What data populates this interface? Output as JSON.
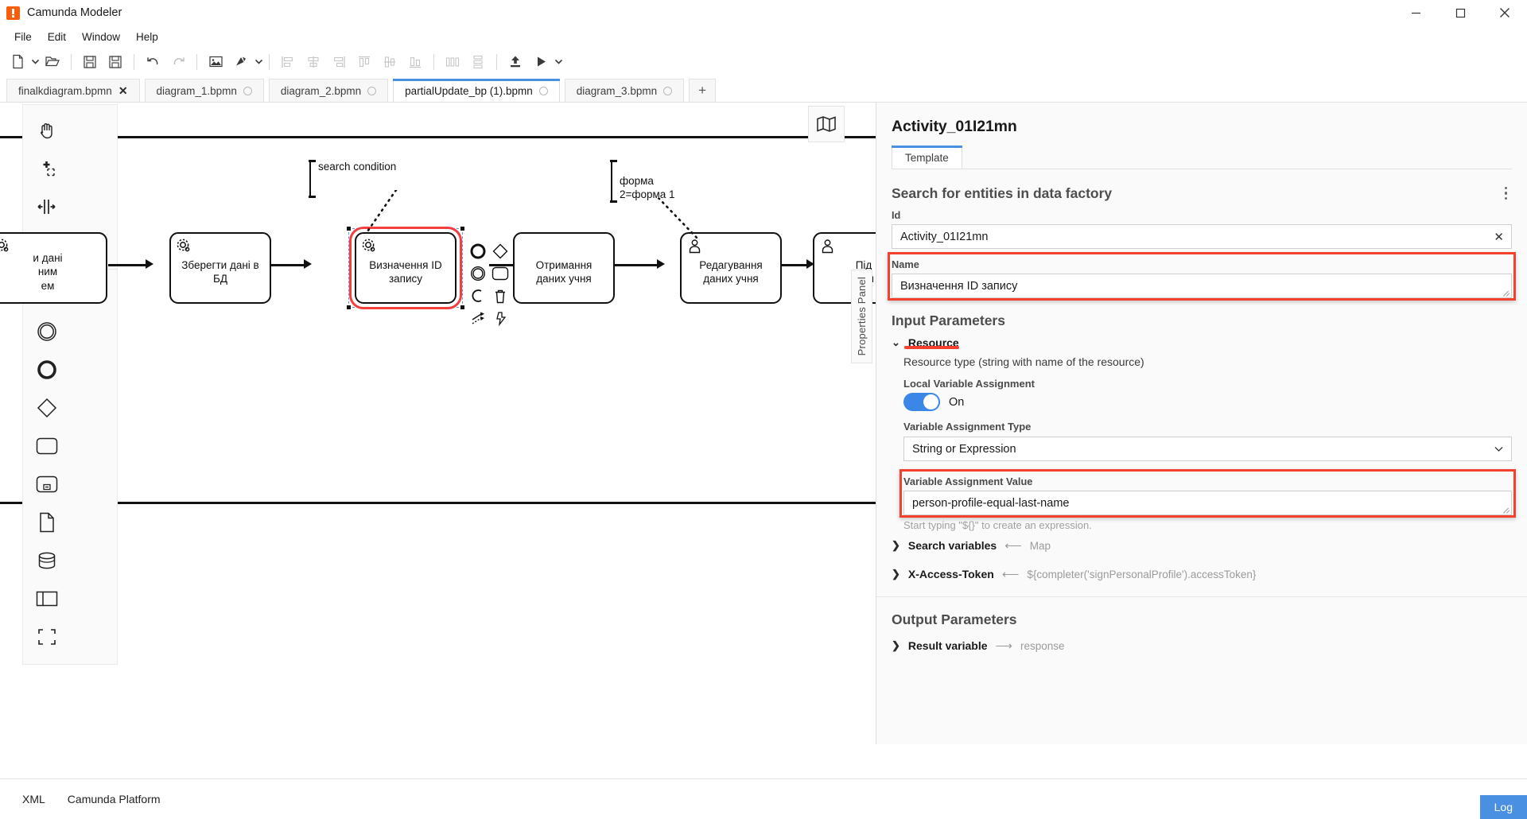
{
  "window": {
    "title": "Camunda Modeler",
    "controls": [
      {
        "name": "minimize",
        "glyph": "minimize-icon"
      },
      {
        "name": "maximize",
        "glyph": "maximize-icon"
      },
      {
        "name": "close",
        "glyph": "close-icon"
      }
    ]
  },
  "menubar": {
    "items": [
      {
        "label": "File"
      },
      {
        "label": "Edit"
      },
      {
        "label": "Window"
      },
      {
        "label": "Help"
      }
    ]
  },
  "toolbar": {
    "buttons": [
      {
        "name": "new-diagram-icon",
        "enabled": true
      },
      {
        "name": "new-diagram-dropdown-caret-icon",
        "enabled": true
      },
      {
        "name": "open-folder-icon",
        "enabled": true
      },
      {
        "name": "save-icon",
        "enabled": true
      },
      {
        "name": "save-as-icon",
        "enabled": true
      },
      {
        "name": "undo-icon",
        "enabled": true
      },
      {
        "name": "redo-icon",
        "enabled": true
      },
      {
        "name": "export-image-icon",
        "enabled": true
      },
      {
        "name": "tool-marker-icon",
        "enabled": true
      },
      {
        "name": "tool-marker-dropdown-caret-icon",
        "enabled": true
      },
      {
        "name": "align-left-icon",
        "enabled": false
      },
      {
        "name": "align-center-icon",
        "enabled": false
      },
      {
        "name": "align-right-icon",
        "enabled": false
      },
      {
        "name": "align-top-icon",
        "enabled": false
      },
      {
        "name": "align-middle-icon",
        "enabled": false
      },
      {
        "name": "align-bottom-icon",
        "enabled": false
      },
      {
        "name": "distribute-horizontal-icon",
        "enabled": false
      },
      {
        "name": "distribute-vertical-icon",
        "enabled": false
      },
      {
        "name": "deploy-icon",
        "enabled": true
      },
      {
        "name": "start-instance-icon",
        "enabled": true
      },
      {
        "name": "start-instance-caret-icon",
        "enabled": true
      }
    ]
  },
  "tabs": {
    "items": [
      {
        "label": "finalkdiagram.bpmn",
        "active": false,
        "indicator": "close"
      },
      {
        "label": "diagram_1.bpmn",
        "active": false,
        "indicator": "dot"
      },
      {
        "label": "diagram_2.bpmn",
        "active": false,
        "indicator": "dot"
      },
      {
        "label": "partialUpdate_bp (1).bpmn",
        "active": true,
        "indicator": "dot"
      },
      {
        "label": "diagram_3.bpmn",
        "active": false,
        "indicator": "dot"
      }
    ],
    "add_label": "+"
  },
  "canvas": {
    "palette": {
      "items": [
        {
          "name": "hand-tool-icon"
        },
        {
          "name": "lasso-tool-icon"
        },
        {
          "name": "space-tool-icon"
        },
        {
          "name": "global-connect-tool-icon"
        },
        {
          "name": "start-event-icon"
        },
        {
          "name": "intermediate-event-icon"
        },
        {
          "name": "end-event-icon"
        },
        {
          "name": "gateway-icon"
        },
        {
          "name": "task-icon"
        },
        {
          "name": "subprocess-expanded-icon"
        },
        {
          "name": "data-object-icon"
        },
        {
          "name": "data-store-icon"
        },
        {
          "name": "participant-icon"
        },
        {
          "name": "group-icon"
        }
      ]
    },
    "minimap_label": "map-icon",
    "tasks": [
      {
        "label": "и дані\nним\nем",
        "type": "service",
        "selected": false
      },
      {
        "label": "Зберегти дані в БД",
        "type": "service",
        "selected": false
      },
      {
        "label": "Визначення ID запису",
        "type": "service",
        "selected": true
      },
      {
        "label": "Отримання даних учня",
        "type": "plain",
        "selected": false
      },
      {
        "label": "Редагування даних учня",
        "type": "user",
        "selected": false
      },
      {
        "label": "Під\nзмін",
        "type": "user",
        "selected": false
      }
    ],
    "annotations": [
      {
        "text": "search condition"
      },
      {
        "text": "форма\n2=форма 1"
      }
    ],
    "properties_tab_label": "Properties Panel"
  },
  "properties": {
    "title": "Activity_01I21mn",
    "tabs": [
      {
        "label": "Template",
        "active": true
      }
    ],
    "template_name": "Search for entities in data factory",
    "kebab_name": "template-menu-icon",
    "fields": {
      "id": {
        "label": "Id",
        "value": "Activity_01I21mn",
        "clear_glyph": "✕"
      },
      "name": {
        "label": "Name",
        "value": "Визначення ID запису",
        "highlighted": true
      }
    },
    "input_parameters": {
      "heading": "Input Parameters",
      "resource_group": {
        "label": "Resource",
        "expanded": true,
        "highlighted": true,
        "description": "Resource type (string with name of the resource)",
        "local_variable_assignment": {
          "label": "Local Variable Assignment",
          "state": "On"
        },
        "variable_assignment_type": {
          "label": "Variable Assignment Type",
          "value": "String or Expression"
        },
        "variable_assignment_value": {
          "label": "Variable Assignment Value",
          "value": "person-profile-equal-last-name",
          "highlighted": true
        },
        "hint": "Start typing \"${}\" to create an expression."
      },
      "collapsed_rows": [
        {
          "name": "Search variables",
          "direction": "in",
          "value": "Map"
        },
        {
          "name": "X-Access-Token",
          "direction": "in",
          "value": "${completer('signPersonalProfile').accessToken}"
        }
      ]
    },
    "output_parameters": {
      "heading": "Output Parameters",
      "collapsed_rows": [
        {
          "name": "Result variable",
          "direction": "out",
          "value": "response"
        }
      ]
    }
  },
  "statusbar": {
    "items": [
      {
        "label": "XML"
      },
      {
        "label": "Camunda Platform"
      }
    ],
    "log_label": "Log"
  },
  "colors": {
    "accent": "#4a90e2",
    "highlight": "#f4402f",
    "toggle_on": "#3b87e8",
    "brand": "#fc5d0d"
  }
}
